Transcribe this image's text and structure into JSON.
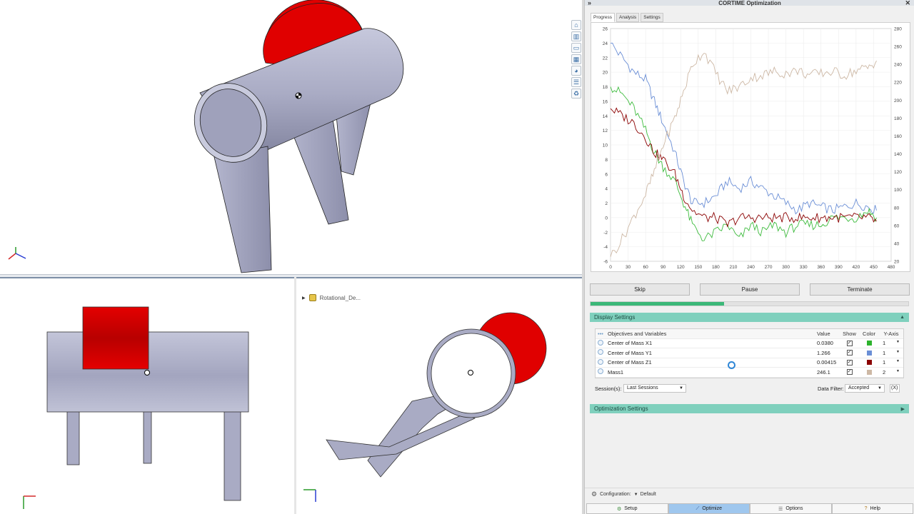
{
  "panel": {
    "title": "CORTIME Optimization",
    "collapse_icon": "»",
    "close_icon": "✕"
  },
  "tabs": [
    "Progress",
    "Analysis",
    "Settings"
  ],
  "side_toolbar": [
    "home-icon",
    "part-icon",
    "folder-icon",
    "layout-icon",
    "color-wheel-icon",
    "list-icon",
    "recycle-icon"
  ],
  "tree": {
    "item_label": "Rotational_De..."
  },
  "chart_data": {
    "type": "line",
    "title": "",
    "x_ticks": [
      0,
      30,
      60,
      90,
      120,
      150,
      180,
      210,
      240,
      270,
      300,
      330,
      360,
      390,
      420,
      450,
      480
    ],
    "y_left_ticks": [
      -6,
      -4,
      -2,
      0,
      2,
      4,
      6,
      8,
      10,
      12,
      14,
      16,
      18,
      20,
      22,
      24,
      26
    ],
    "y_right_ticks": [
      20,
      40,
      60,
      80,
      100,
      120,
      140,
      160,
      180,
      200,
      220,
      240,
      260,
      280
    ],
    "xlim": [
      0,
      480
    ],
    "ylim_left": [
      -6,
      26
    ],
    "ylim_right": [
      20,
      280
    ],
    "grid": true,
    "series": [
      {
        "name": "Center of Mass Y1",
        "color": "#6b8fd6",
        "axis": 1,
        "x": [
          0,
          20,
          40,
          60,
          75,
          90,
          110,
          125,
          140,
          160,
          180,
          200,
          220,
          240,
          260,
          280,
          300,
          320,
          340,
          360,
          380,
          400,
          420,
          440,
          455
        ],
        "y": [
          24,
          22,
          20,
          19,
          16,
          13,
          9,
          5,
          2,
          2,
          3,
          5,
          4,
          5,
          4,
          3,
          2,
          1,
          2,
          1.5,
          1,
          1.5,
          2,
          1.5,
          1
        ]
      },
      {
        "name": "Center of Mass X1",
        "color": "#3dbb3d",
        "axis": 1,
        "x": [
          0,
          20,
          40,
          60,
          75,
          90,
          110,
          125,
          140,
          160,
          180,
          200,
          220,
          240,
          260,
          280,
          300,
          320,
          340,
          360,
          380,
          400,
          420,
          440,
          455
        ],
        "y": [
          18,
          17,
          15,
          12,
          9,
          7,
          5,
          2,
          -1,
          -3,
          -2,
          -1,
          -3,
          -1,
          -2,
          -1,
          -2,
          -1,
          -1,
          -1,
          0,
          0,
          0,
          1,
          0
        ]
      },
      {
        "name": "Center of Mass Z1",
        "color": "#8b0000",
        "axis": 1,
        "x": [
          0,
          20,
          40,
          60,
          75,
          90,
          110,
          125,
          140,
          160,
          180,
          200,
          220,
          240,
          260,
          280,
          300,
          320,
          340,
          360,
          380,
          400,
          420,
          440,
          455
        ],
        "y": [
          15,
          14,
          13,
          11,
          9,
          8,
          6,
          3,
          1,
          0,
          0,
          -1,
          0,
          0,
          0,
          0,
          0,
          0,
          0,
          0,
          0,
          0,
          0,
          0,
          -0.5
        ]
      },
      {
        "name": "Mass1",
        "color": "#cdb8a5",
        "axis": 2,
        "x": [
          0,
          20,
          40,
          60,
          75,
          90,
          110,
          125,
          140,
          160,
          180,
          200,
          220,
          240,
          260,
          280,
          300,
          320,
          340,
          360,
          380,
          400,
          420,
          440,
          455
        ],
        "y": [
          25,
          45,
          70,
          95,
          120,
          150,
          180,
          210,
          240,
          255,
          230,
          210,
          215,
          225,
          228,
          232,
          230,
          233,
          228,
          230,
          232,
          228,
          233,
          236,
          244
        ]
      }
    ]
  },
  "buttons": {
    "skip": "Skip",
    "pause": "Pause",
    "terminate": "Terminate"
  },
  "progress": {
    "value": 0.42
  },
  "display_settings": {
    "title": "Display Settings",
    "collapse_icon": "▲",
    "headers": {
      "menu": "•••",
      "name": "Objectives and Variables",
      "value": "Value",
      "show": "Show",
      "color": "Color",
      "yaxis": "Y-Axis"
    },
    "rows": [
      {
        "name": "Center of Mass X1",
        "value": "0.0380",
        "show": true,
        "color": "#2db32d",
        "axis": "1"
      },
      {
        "name": "Center of Mass Y1",
        "value": "1.266",
        "show": true,
        "color": "#6b8fd6",
        "axis": "1"
      },
      {
        "name": "Center of Mass Z1",
        "value": "0.00415",
        "show": true,
        "color": "#8b0000",
        "axis": "1"
      },
      {
        "name": "Mass1",
        "value": "246.1",
        "show": true,
        "color": "#cdb8a5",
        "axis": "2"
      }
    ],
    "sessions_label": "Session(s):",
    "sessions_value": "Last Sessions",
    "filter_label": "Data Filter:",
    "filter_value": "Accepted",
    "filter_clear": "(X)"
  },
  "optimization_settings": {
    "title": "Optimization Settings",
    "expand_icon": "▶"
  },
  "configuration": {
    "label": "Configuration:",
    "value": "Default"
  },
  "bottom_tabs": [
    "Setup",
    "Optimize",
    "Options",
    "Help"
  ],
  "colors": {
    "accent_teal": "#7fd0bd",
    "progress_green": "#3cb878",
    "part_gray": "#a9abc4",
    "part_red": "#e00000"
  }
}
